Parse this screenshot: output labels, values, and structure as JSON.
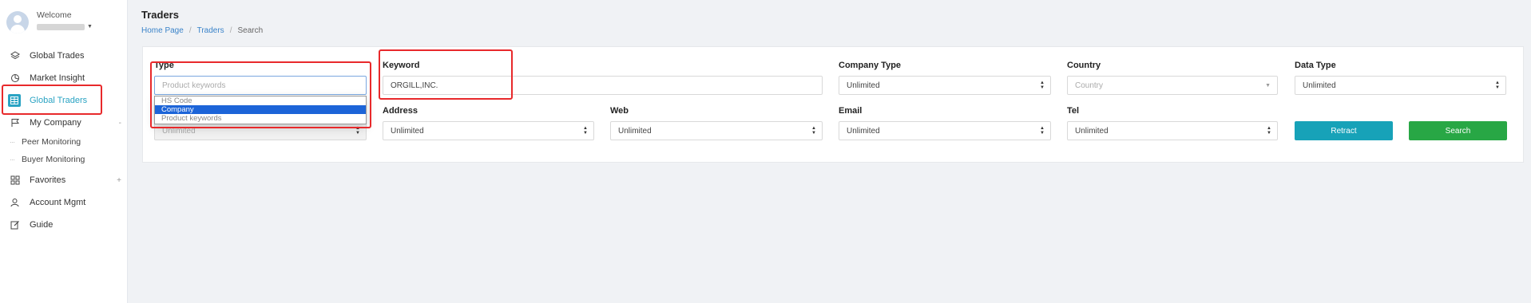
{
  "sidebar": {
    "welcome": "Welcome",
    "items": [
      {
        "label": "Global Trades",
        "icon": "layers-icon"
      },
      {
        "label": "Market Insight",
        "icon": "pie-chart-icon"
      },
      {
        "label": "Global Traders",
        "icon": "table-icon",
        "active": true
      },
      {
        "label": "My Company",
        "icon": "flag-icon",
        "suffix": "-"
      },
      {
        "label": "Peer Monitoring",
        "sub": true
      },
      {
        "label": "Buyer Monitoring",
        "sub": true
      },
      {
        "label": "Favorites",
        "icon": "grid-icon",
        "suffix": "+"
      },
      {
        "label": "Account Mgmt",
        "icon": "user-settings-icon"
      },
      {
        "label": "Guide",
        "icon": "edit-icon"
      }
    ]
  },
  "header": {
    "title": "Traders",
    "breadcrumb": [
      "Home Page",
      "Traders",
      "Search"
    ]
  },
  "form": {
    "type": {
      "label": "Type",
      "placeholder": "Product keywords",
      "value": "Unlimited"
    },
    "keyword": {
      "label": "Keyword",
      "value": "ORGILL,INC."
    },
    "company_type": {
      "label": "Company Type",
      "value": "Unlimited"
    },
    "country": {
      "label": "Country",
      "placeholder": "Country"
    },
    "data_type": {
      "label": "Data Type",
      "value": "Unlimited"
    },
    "address": {
      "label": "Address",
      "value": "Unlimited"
    },
    "web": {
      "label": "Web",
      "value": "Unlimited"
    },
    "email": {
      "label": "Email",
      "value": "Unlimited"
    },
    "tel": {
      "label": "Tel",
      "value": "Unlimited"
    },
    "retract_label": "Retract",
    "search_label": "Search"
  },
  "type_dropdown": {
    "options": [
      "HS Code",
      "Company",
      "Product keywords"
    ],
    "selected": "Company"
  },
  "colors": {
    "accent": "#2aa3c3",
    "retract": "#17a2b8",
    "search": "#28a745",
    "annotation": "#e8292b",
    "dropdown_selected": "#1c64d8"
  }
}
